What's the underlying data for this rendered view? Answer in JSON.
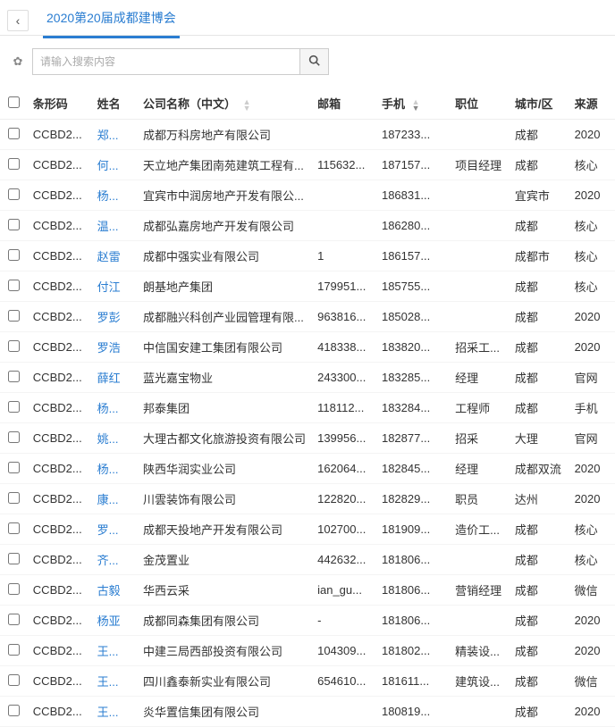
{
  "header": {
    "back_glyph": "‹",
    "tab_label": "2020第20届成都建博会"
  },
  "search": {
    "gear_glyph": "✿",
    "placeholder": "请输入搜索内容",
    "search_glyph": "🔍"
  },
  "columns": {
    "barcode": "条形码",
    "name": "姓名",
    "company": "公司名称（中文）",
    "email": "邮箱",
    "phone": "手机",
    "position": "职位",
    "city": "城市/区",
    "source": "来源"
  },
  "rows": [
    {
      "barcode": "CCBD2...",
      "name": "郑...",
      "company": "成都万科房地产有限公司",
      "email": "",
      "phone": "187233...",
      "position": "",
      "city": "成都",
      "source": "2020"
    },
    {
      "barcode": "CCBD2...",
      "name": "何...",
      "company": "天立地产集团南苑建筑工程有...",
      "email": "115632...",
      "phone": "187157...",
      "position": "项目经理",
      "city": "成都",
      "source": "核心"
    },
    {
      "barcode": "CCBD2...",
      "name": "杨...",
      "company": "宜宾市中润房地产开发有限公...",
      "email": "",
      "phone": "186831...",
      "position": "",
      "city": "宜宾市",
      "source": "2020"
    },
    {
      "barcode": "CCBD2...",
      "name": "温...",
      "company": "成都弘嘉房地产开发有限公司",
      "email": "",
      "phone": "186280...",
      "position": "",
      "city": "成都",
      "source": "核心"
    },
    {
      "barcode": "CCBD2...",
      "name": "赵雷",
      "company": "成都中强实业有限公司",
      "email": "1",
      "phone": "186157...",
      "position": "",
      "city": "成都市",
      "source": "核心"
    },
    {
      "barcode": "CCBD2...",
      "name": "付江",
      "company": "朗基地产集团",
      "email": "179951...",
      "phone": "185755...",
      "position": "",
      "city": "成都",
      "source": "核心"
    },
    {
      "barcode": "CCBD2...",
      "name": "罗彭",
      "company": "成都融兴科创产业园管理有限...",
      "email": "963816...",
      "phone": "185028...",
      "position": "",
      "city": "成都",
      "source": "2020"
    },
    {
      "barcode": "CCBD2...",
      "name": "罗浩",
      "company": "中信国安建工集团有限公司",
      "email": "418338...",
      "phone": "183820...",
      "position": "招采工...",
      "city": "成都",
      "source": "2020"
    },
    {
      "barcode": "CCBD2...",
      "name": "薛红",
      "company": "蓝光嘉宝物业",
      "email": "243300...",
      "phone": "183285...",
      "position": "经理",
      "city": "成都",
      "source": "官网"
    },
    {
      "barcode": "CCBD2...",
      "name": "杨...",
      "company": "邦泰集团",
      "email": "118112...",
      "phone": "183284...",
      "position": "工程师",
      "city": "成都",
      "source": "手机"
    },
    {
      "barcode": "CCBD2...",
      "name": "姚...",
      "company": "大理古都文化旅游投资有限公司",
      "email": "139956...",
      "phone": "182877...",
      "position": "招采",
      "city": "大理",
      "source": "官网"
    },
    {
      "barcode": "CCBD2...",
      "name": "杨...",
      "company": "陕西华润实业公司",
      "email": "162064...",
      "phone": "182845...",
      "position": "经理",
      "city": "成都双流",
      "source": "2020"
    },
    {
      "barcode": "CCBD2...",
      "name": "康...",
      "company": "川雲装饰有限公司",
      "email": "122820...",
      "phone": "182829...",
      "position": "职员",
      "city": "达州",
      "source": "2020"
    },
    {
      "barcode": "CCBD2...",
      "name": "罗...",
      "company": "成都天投地产开发有限公司",
      "email": "102700...",
      "phone": "181909...",
      "position": "造价工...",
      "city": "成都",
      "source": "核心"
    },
    {
      "barcode": "CCBD2...",
      "name": "齐...",
      "company": "金茂置业",
      "email": "442632...",
      "phone": "181806...",
      "position": "",
      "city": "成都",
      "source": "核心"
    },
    {
      "barcode": "CCBD2...",
      "name": "古毅",
      "company": "华西云采",
      "email": "ian_gu...",
      "phone": "181806...",
      "position": "营销经理",
      "city": "成都",
      "source": "微信"
    },
    {
      "barcode": "CCBD2...",
      "name": "杨亚",
      "company": "成都同森集团有限公司",
      "email": "-",
      "phone": "181806...",
      "position": "",
      "city": "成都",
      "source": "2020"
    },
    {
      "barcode": "CCBD2...",
      "name": "王...",
      "company": "中建三局西部投资有限公司",
      "email": "104309...",
      "phone": "181802...",
      "position": "精装设...",
      "city": "成都",
      "source": "2020"
    },
    {
      "barcode": "CCBD2...",
      "name": "王...",
      "company": "四川鑫泰新实业有限公司",
      "email": "654610...",
      "phone": "181611...",
      "position": "建筑设...",
      "city": "成都",
      "source": "微信"
    },
    {
      "barcode": "CCBD2...",
      "name": "王...",
      "company": "炎华置信集团有限公司",
      "email": "",
      "phone": "180819...",
      "position": "",
      "city": "成都",
      "source": "2020"
    }
  ]
}
